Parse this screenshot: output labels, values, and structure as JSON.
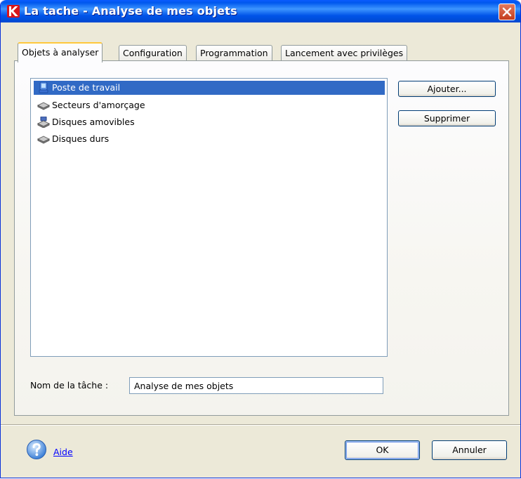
{
  "window": {
    "title": "La tache - Analyse de mes objets"
  },
  "tabs": [
    {
      "label": "Objets à analyser",
      "active": true
    },
    {
      "label": "Configuration",
      "active": false
    },
    {
      "label": "Programmation",
      "active": false
    },
    {
      "label": "Lancement avec privilèges",
      "active": false
    }
  ],
  "objects_list": {
    "items": [
      {
        "label": "Poste de travail",
        "icon": "computer-icon",
        "selected": true
      },
      {
        "label": "Secteurs d'amorçage",
        "icon": "hard-drive-icon",
        "selected": false
      },
      {
        "label": "Disques amovibles",
        "icon": "removable-drives-icon",
        "selected": false
      },
      {
        "label": "Disques durs",
        "icon": "hard-drive-icon",
        "selected": false
      }
    ]
  },
  "buttons": {
    "add": "Ajouter...",
    "remove": "Supprimer",
    "ok": "OK",
    "cancel": "Annuler"
  },
  "task_name": {
    "label": "Nom de la tâche :",
    "value": "Analyse de mes objets"
  },
  "footer": {
    "help_label": "Aide"
  },
  "colors": {
    "title_bar": "#0058ee",
    "selection": "#316ac5",
    "close_button": "#c43d1c",
    "dialog_bg": "#ece9d8",
    "link": "#0000ff"
  }
}
